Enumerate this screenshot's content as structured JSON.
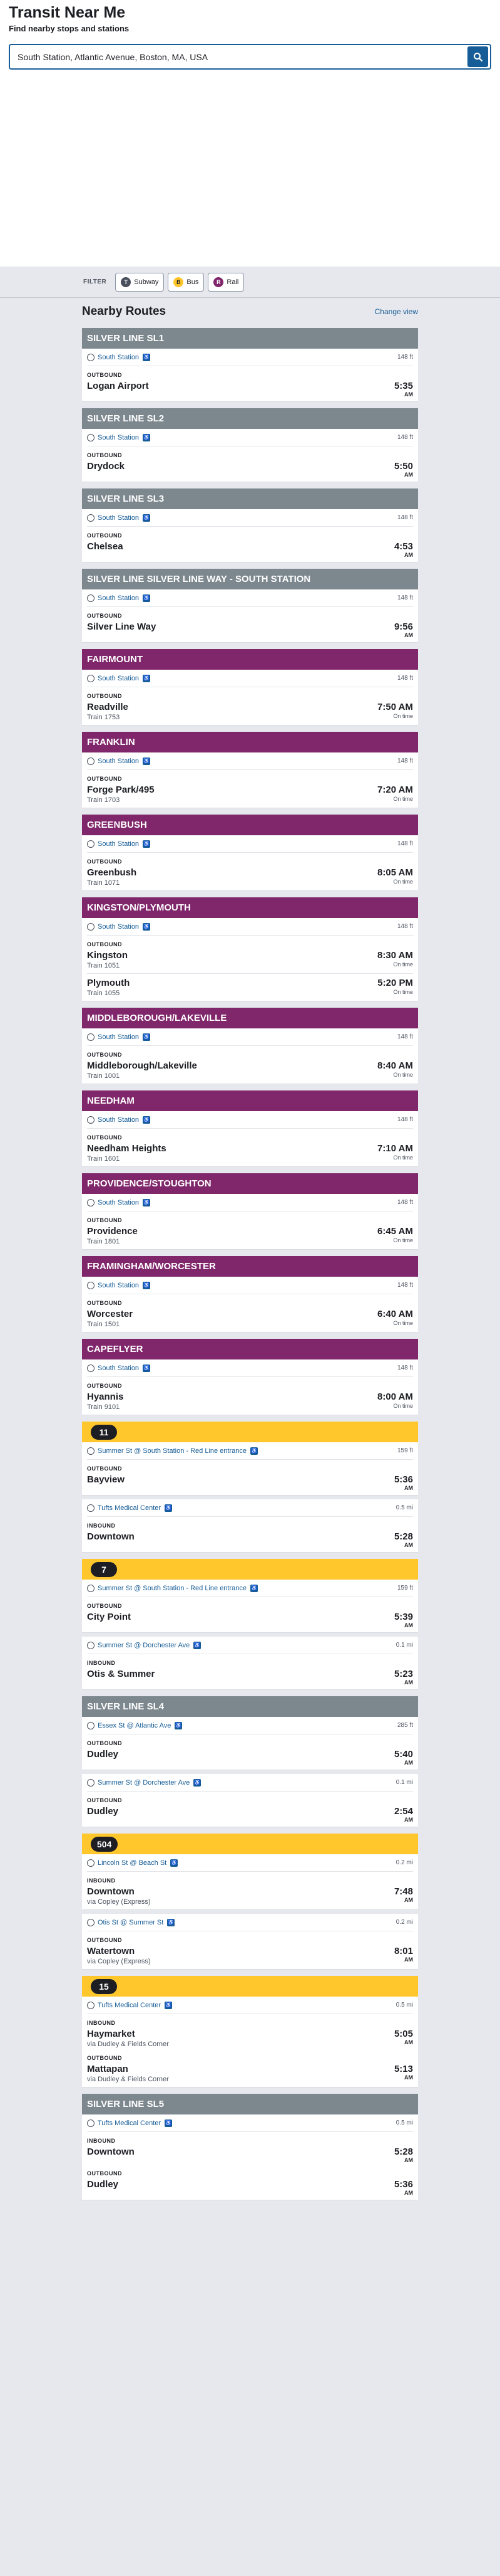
{
  "app": {
    "title": "Transit Near Me",
    "subtitle": "Find nearby stops and stations"
  },
  "search": {
    "value": "South Station, Atlantic Avenue, Boston, MA, USA"
  },
  "filter": {
    "label": "FILTER",
    "subway": "Subway",
    "bus": "Bus",
    "rail": "Rail"
  },
  "main": {
    "heading": "Nearby Routes",
    "change_view": "Change view"
  },
  "colors": {
    "rail": "#80276c",
    "bus": "#ffc72c",
    "silver": "#7c878e",
    "link": "#165c96"
  },
  "routes": [
    {
      "name": "SILVER LINE SL1",
      "type": "sl",
      "stops": [
        {
          "name": "South Station",
          "dist": "148 ft",
          "dirs": [
            {
              "dir": "OUTBOUND",
              "deps": [
                {
                  "hs": "Logan Airport",
                  "sub": "",
                  "time": "5:35",
                  "ampm": "AM",
                  "status": ""
                }
              ]
            }
          ]
        }
      ]
    },
    {
      "name": "SILVER LINE SL2",
      "type": "sl",
      "stops": [
        {
          "name": "South Station",
          "dist": "148 ft",
          "dirs": [
            {
              "dir": "OUTBOUND",
              "deps": [
                {
                  "hs": "Drydock",
                  "sub": "",
                  "time": "5:50",
                  "ampm": "AM",
                  "status": ""
                }
              ]
            }
          ]
        }
      ]
    },
    {
      "name": "SILVER LINE SL3",
      "type": "sl",
      "stops": [
        {
          "name": "South Station",
          "dist": "148 ft",
          "dirs": [
            {
              "dir": "OUTBOUND",
              "deps": [
                {
                  "hs": "Chelsea",
                  "sub": "",
                  "time": "4:53",
                  "ampm": "AM",
                  "status": ""
                }
              ]
            }
          ]
        }
      ]
    },
    {
      "name": "SILVER LINE SILVER LINE WAY - SOUTH STATION",
      "type": "sl",
      "stops": [
        {
          "name": "South Station",
          "dist": "148 ft",
          "dirs": [
            {
              "dir": "OUTBOUND",
              "deps": [
                {
                  "hs": "Silver Line Way",
                  "sub": "",
                  "time": "9:56",
                  "ampm": "AM",
                  "status": ""
                }
              ]
            }
          ]
        }
      ]
    },
    {
      "name": "FAIRMOUNT",
      "type": "rail",
      "stops": [
        {
          "name": "South Station",
          "dist": "148 ft",
          "dirs": [
            {
              "dir": "OUTBOUND",
              "deps": [
                {
                  "hs": "Readville",
                  "sub": "Train 1753",
                  "time": "7:50 AM",
                  "ampm": "",
                  "status": "On time"
                }
              ]
            }
          ]
        }
      ]
    },
    {
      "name": "FRANKLIN",
      "type": "rail",
      "stops": [
        {
          "name": "South Station",
          "dist": "148 ft",
          "dirs": [
            {
              "dir": "OUTBOUND",
              "deps": [
                {
                  "hs": "Forge Park/495",
                  "sub": "Train 1703",
                  "time": "7:20 AM",
                  "ampm": "",
                  "status": "On time"
                }
              ]
            }
          ]
        }
      ]
    },
    {
      "name": "GREENBUSH",
      "type": "rail",
      "stops": [
        {
          "name": "South Station",
          "dist": "148 ft",
          "dirs": [
            {
              "dir": "OUTBOUND",
              "deps": [
                {
                  "hs": "Greenbush",
                  "sub": "Train 1071",
                  "time": "8:05 AM",
                  "ampm": "",
                  "status": "On time"
                }
              ]
            }
          ]
        }
      ]
    },
    {
      "name": "KINGSTON/PLYMOUTH",
      "type": "rail",
      "stops": [
        {
          "name": "South Station",
          "dist": "148 ft",
          "dirs": [
            {
              "dir": "OUTBOUND",
              "deps": [
                {
                  "hs": "Kingston",
                  "sub": "Train 1051",
                  "time": "8:30 AM",
                  "ampm": "",
                  "status": "On time"
                },
                {
                  "hs": "Plymouth",
                  "sub": "Train 1055",
                  "time": "5:20 PM",
                  "ampm": "",
                  "status": "On time"
                }
              ]
            }
          ]
        }
      ]
    },
    {
      "name": "MIDDLEBOROUGH/LAKEVILLE",
      "type": "rail",
      "stops": [
        {
          "name": "South Station",
          "dist": "148 ft",
          "dirs": [
            {
              "dir": "OUTBOUND",
              "deps": [
                {
                  "hs": "Middleborough/Lakeville",
                  "sub": "Train 1001",
                  "time": "8:40 AM",
                  "ampm": "",
                  "status": "On time"
                }
              ]
            }
          ]
        }
      ]
    },
    {
      "name": "NEEDHAM",
      "type": "rail",
      "stops": [
        {
          "name": "South Station",
          "dist": "148 ft",
          "dirs": [
            {
              "dir": "OUTBOUND",
              "deps": [
                {
                  "hs": "Needham Heights",
                  "sub": "Train 1601",
                  "time": "7:10 AM",
                  "ampm": "",
                  "status": "On time"
                }
              ]
            }
          ]
        }
      ]
    },
    {
      "name": "PROVIDENCE/STOUGHTON",
      "type": "rail",
      "stops": [
        {
          "name": "South Station",
          "dist": "148 ft",
          "dirs": [
            {
              "dir": "OUTBOUND",
              "deps": [
                {
                  "hs": "Providence",
                  "sub": "Train 1801",
                  "time": "6:45 AM",
                  "ampm": "",
                  "status": "On time"
                }
              ]
            }
          ]
        }
      ]
    },
    {
      "name": "FRAMINGHAM/WORCESTER",
      "type": "rail",
      "stops": [
        {
          "name": "South Station",
          "dist": "148 ft",
          "dirs": [
            {
              "dir": "OUTBOUND",
              "deps": [
                {
                  "hs": "Worcester",
                  "sub": "Train 1501",
                  "time": "6:40 AM",
                  "ampm": "",
                  "status": "On time"
                }
              ]
            }
          ]
        }
      ]
    },
    {
      "name": "CAPEFLYER",
      "type": "rail",
      "stops": [
        {
          "name": "South Station",
          "dist": "148 ft",
          "dirs": [
            {
              "dir": "OUTBOUND",
              "deps": [
                {
                  "hs": "Hyannis",
                  "sub": "Train 9101",
                  "time": "8:00 AM",
                  "ampm": "",
                  "status": "On time"
                }
              ]
            }
          ]
        }
      ]
    },
    {
      "name": "11",
      "type": "bus",
      "stops": [
        {
          "name": "Summer St @ South Station - Red Line entrance",
          "dist": "159 ft",
          "dirs": [
            {
              "dir": "OUTBOUND",
              "deps": [
                {
                  "hs": "Bayview",
                  "sub": "",
                  "time": "5:36",
                  "ampm": "AM",
                  "status": ""
                }
              ]
            }
          ]
        },
        {
          "name": "Tufts Medical Center",
          "dist": "0.5 mi",
          "dirs": [
            {
              "dir": "INBOUND",
              "deps": [
                {
                  "hs": "Downtown",
                  "sub": "",
                  "time": "5:28",
                  "ampm": "AM",
                  "status": ""
                }
              ]
            }
          ]
        }
      ]
    },
    {
      "name": "7",
      "type": "bus",
      "stops": [
        {
          "name": "Summer St @ South Station - Red Line entrance",
          "dist": "159 ft",
          "dirs": [
            {
              "dir": "OUTBOUND",
              "deps": [
                {
                  "hs": "City Point",
                  "sub": "",
                  "time": "5:39",
                  "ampm": "AM",
                  "status": ""
                }
              ]
            }
          ]
        },
        {
          "name": "Summer St @ Dorchester Ave",
          "dist": "0.1 mi",
          "dirs": [
            {
              "dir": "INBOUND",
              "deps": [
                {
                  "hs": "Otis & Summer",
                  "sub": "",
                  "time": "5:23",
                  "ampm": "AM",
                  "status": ""
                }
              ]
            }
          ]
        }
      ]
    },
    {
      "name": "SILVER LINE SL4",
      "type": "sl",
      "stops": [
        {
          "name": "Essex St @ Atlantic Ave",
          "dist": "285 ft",
          "dirs": [
            {
              "dir": "OUTBOUND",
              "deps": [
                {
                  "hs": "Dudley",
                  "sub": "",
                  "time": "5:40",
                  "ampm": "AM",
                  "status": ""
                }
              ]
            }
          ]
        },
        {
          "name": "Summer St @ Dorchester Ave",
          "dist": "0.1 mi",
          "dirs": [
            {
              "dir": "OUTBOUND",
              "deps": [
                {
                  "hs": "Dudley",
                  "sub": "",
                  "time": "2:54",
                  "ampm": "AM",
                  "status": ""
                }
              ]
            }
          ]
        }
      ]
    },
    {
      "name": "504",
      "type": "bus",
      "stops": [
        {
          "name": "Lincoln St @ Beach St",
          "dist": "0.2 mi",
          "dirs": [
            {
              "dir": "INBOUND",
              "deps": [
                {
                  "hs": "Downtown",
                  "sub": "via Copley (Express)",
                  "time": "7:48",
                  "ampm": "AM",
                  "status": ""
                }
              ]
            }
          ]
        },
        {
          "name": "Otis St @ Summer St",
          "dist": "0.2 mi",
          "dirs": [
            {
              "dir": "OUTBOUND",
              "deps": [
                {
                  "hs": "Watertown",
                  "sub": "via Copley (Express)",
                  "time": "8:01",
                  "ampm": "AM",
                  "status": ""
                }
              ]
            }
          ]
        }
      ]
    },
    {
      "name": "15",
      "type": "bus",
      "stops": [
        {
          "name": "Tufts Medical Center",
          "dist": "0.5 mi",
          "dirs": [
            {
              "dir": "INBOUND",
              "deps": [
                {
                  "hs": "Haymarket",
                  "sub": "via Dudley & Fields Corner",
                  "time": "5:05",
                  "ampm": "AM",
                  "status": ""
                }
              ]
            },
            {
              "dir": "OUTBOUND",
              "deps": [
                {
                  "hs": "Mattapan",
                  "sub": "via Dudley & Fields Corner",
                  "time": "5:13",
                  "ampm": "AM",
                  "status": ""
                }
              ]
            }
          ]
        }
      ]
    },
    {
      "name": "SILVER LINE SL5",
      "type": "sl",
      "stops": [
        {
          "name": "Tufts Medical Center",
          "dist": "0.5 mi",
          "dirs": [
            {
              "dir": "INBOUND",
              "deps": [
                {
                  "hs": "Downtown",
                  "sub": "",
                  "time": "5:28",
                  "ampm": "AM",
                  "status": ""
                }
              ]
            },
            {
              "dir": "OUTBOUND",
              "deps": [
                {
                  "hs": "Dudley",
                  "sub": "",
                  "time": "5:36",
                  "ampm": "AM",
                  "status": ""
                }
              ]
            }
          ]
        }
      ]
    }
  ]
}
